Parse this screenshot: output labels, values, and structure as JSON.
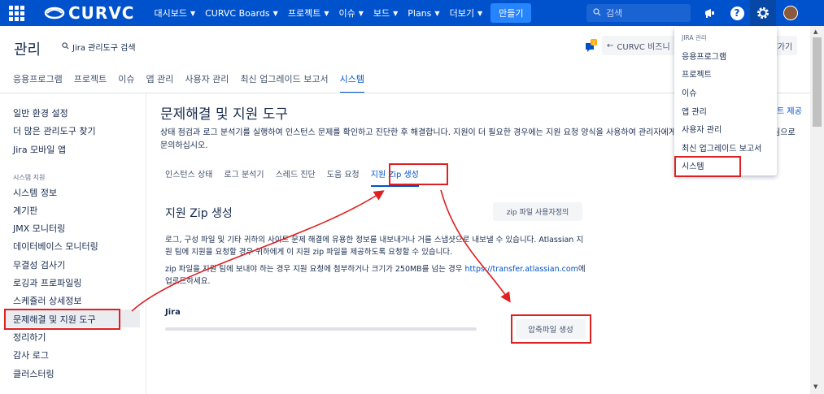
{
  "topnav": {
    "logo_text": "CURVC",
    "items": [
      {
        "label": "대시보드",
        "caret": true
      },
      {
        "label": "CURVC Boards",
        "caret": true
      },
      {
        "label": "프로젝트",
        "caret": true
      },
      {
        "label": "이슈",
        "caret": true
      },
      {
        "label": "보드",
        "caret": true
      },
      {
        "label": "Plans",
        "caret": true
      },
      {
        "label": "더보기",
        "caret": true
      }
    ],
    "create_label": "만들기",
    "search_placeholder": "검색",
    "icons": [
      "apps-grid-icon",
      "curvc-logo-icon",
      "search-icon",
      "megaphone-icon",
      "help-icon",
      "gear-icon",
      "avatar"
    ],
    "colors": {
      "bar": "#0052cc",
      "create": "#2684ff",
      "active_gear": "#0747a6"
    }
  },
  "admin": {
    "title": "관리",
    "search_label": "Jira 관리도구 검색",
    "feedback_badge": "2",
    "back_button": "CURVC 비즈니",
    "back_button2": "가기",
    "tabs": [
      "응용프로그램",
      "프로젝트",
      "이슈",
      "앱 관리",
      "사용자 관리",
      "최신 업그레이드 보고서",
      "시스템"
    ],
    "active_tab": "시스템"
  },
  "sidebar": {
    "top_items": [
      "일반 환경 설정",
      "더 많은 관리도구 찾기",
      "Jira 모바일 앱"
    ],
    "section_label": "시스템 지원",
    "items": [
      "시스템 정보",
      "계기판",
      "JMX 모니터링",
      "데이터베이스 모니터링",
      "무결성 검사기",
      "로깅과 프로파일링",
      "스케쥴러 상세정보",
      "문제해결 및 지원 도구",
      "정리하기",
      "감사 로그",
      "클러스터링"
    ],
    "selected": "문제해결 및 지원 도구"
  },
  "main": {
    "title": "문제해결 및 지원 도구",
    "right_link": "트 제공",
    "description": "상태 점검과 로그 분석기를 실행하여 인스턴스 문제를 확인하고 진단한 후 해결합니다. 지원이 더 필요한 경우에는 지원 요청 양식을 사용하여 관리자에게 문의하거나 Atlassian 지원팀으로 문의하십시오.",
    "sub_tabs": [
      "인스턴스 상태",
      "로그 분석기",
      "스레드 진단",
      "도움 요청",
      "지원 Zip 생성"
    ],
    "active_sub_tab": "지원 Zip 생성",
    "section_title": "지원 Zip 생성",
    "custom_button": "zip 파일 사용자정의",
    "para1": "로그, 구성 파일 및 기타 귀하의 사이트 문제 해결에 유용한 정보를 내보내거나 거를 스냅샷으로 내보낼 수 있습니다. Atlassian 지원 팀에 지원을 요청할 경우 귀하에게 이 지원 zip 파일을 제공하도록 요청할 수 있습니다.",
    "para2_text": "zip 파일을 지원 팀에 보내야 하는 경우 지원 요청에 첨부하거나 크기가 250MB를 넘는 경우",
    "para2_link": "https://transfer.atlassian.com",
    "para2_suffix": "에 업로드하세요.",
    "jira_label": "Jira",
    "progress": 0,
    "generate_button": "압축파일 생성"
  },
  "dropdown": {
    "header": "JIRA 관리",
    "items": [
      "응용프로그램",
      "프로젝트",
      "이슈",
      "앱 관리",
      "사용자 관리",
      "최신 업그레이드 보고서",
      "시스템"
    ],
    "highlighted": "시스템"
  },
  "annotations": {
    "color": "#e02020",
    "boxes": [
      "dropdown-system",
      "sidebar-troubleshooting",
      "subtab-support-zip",
      "generate-button"
    ]
  }
}
